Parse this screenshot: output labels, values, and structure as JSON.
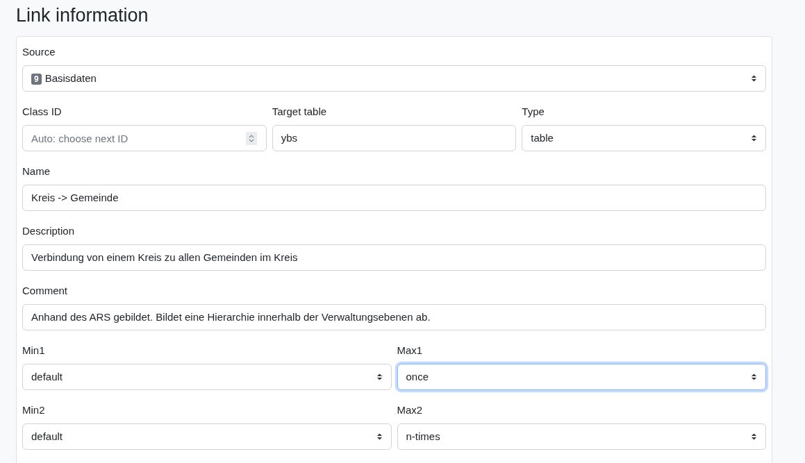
{
  "title": "Link information",
  "rows": [
    [
      {
        "kind": "select",
        "label": "Source",
        "badge": "9",
        "value": "Basisdaten",
        "focused": false
      }
    ],
    [
      {
        "kind": "number",
        "label": "Class ID",
        "placeholder": "Auto: choose next ID",
        "focused": false
      },
      {
        "kind": "text",
        "label": "Target table",
        "value": "ybs",
        "focused": false
      },
      {
        "kind": "select",
        "label": "Type",
        "value": "table",
        "focused": false
      }
    ],
    [
      {
        "kind": "text",
        "label": "Name",
        "value": "Kreis -> Gemeinde",
        "focused": false
      }
    ],
    [
      {
        "kind": "text",
        "label": "Description",
        "value": "Verbindung von einem Kreis zu allen Gemeinden im Kreis",
        "focused": false
      }
    ],
    [
      {
        "kind": "text",
        "label": "Comment",
        "value": "Anhand des ARS gebildet. Bildet eine Hierarchie innerhalb der Verwaltungsebenen ab.",
        "focused": false
      }
    ],
    [
      {
        "kind": "select",
        "label": "Min1",
        "value": "default",
        "focused": false
      },
      {
        "kind": "select",
        "label": "Max1",
        "value": "once",
        "focused": true
      }
    ],
    [
      {
        "kind": "select",
        "label": "Min2",
        "value": "default",
        "focused": false
      },
      {
        "kind": "select",
        "label": "Max2",
        "value": "n-times",
        "focused": false
      }
    ]
  ]
}
